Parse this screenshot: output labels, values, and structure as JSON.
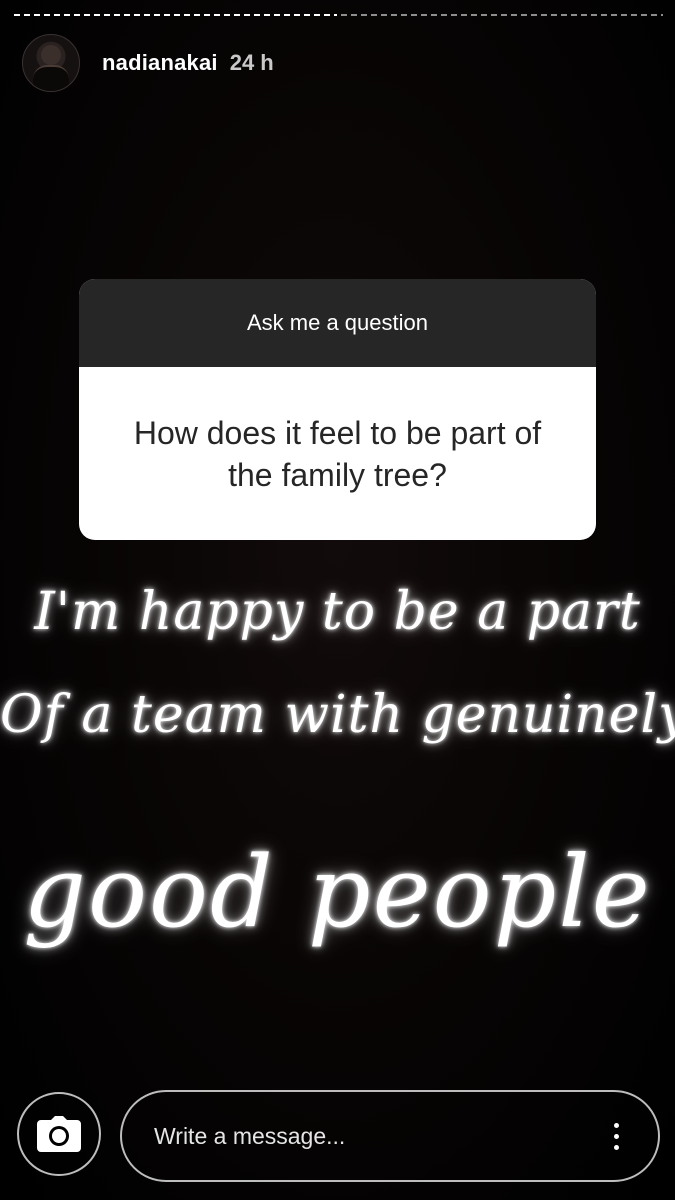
{
  "story": {
    "segments": [
      {
        "state": "viewed"
      },
      {
        "state": "unviewed"
      }
    ]
  },
  "header": {
    "username": "nadianakai",
    "timestamp": "24 h"
  },
  "question_sticker": {
    "title": "Ask me a question",
    "question": "How does it feel to be part of the family tree?",
    "header_color": "#262626",
    "body_color": "#ffffff"
  },
  "answer_text": {
    "line1": "I'm happy to be a part",
    "line2": "Of a team with genuinely",
    "line3": "good people"
  },
  "footer": {
    "camera_icon": "camera-icon",
    "message_placeholder": "Write a message...",
    "more_icon": "more-vertical-icon"
  }
}
